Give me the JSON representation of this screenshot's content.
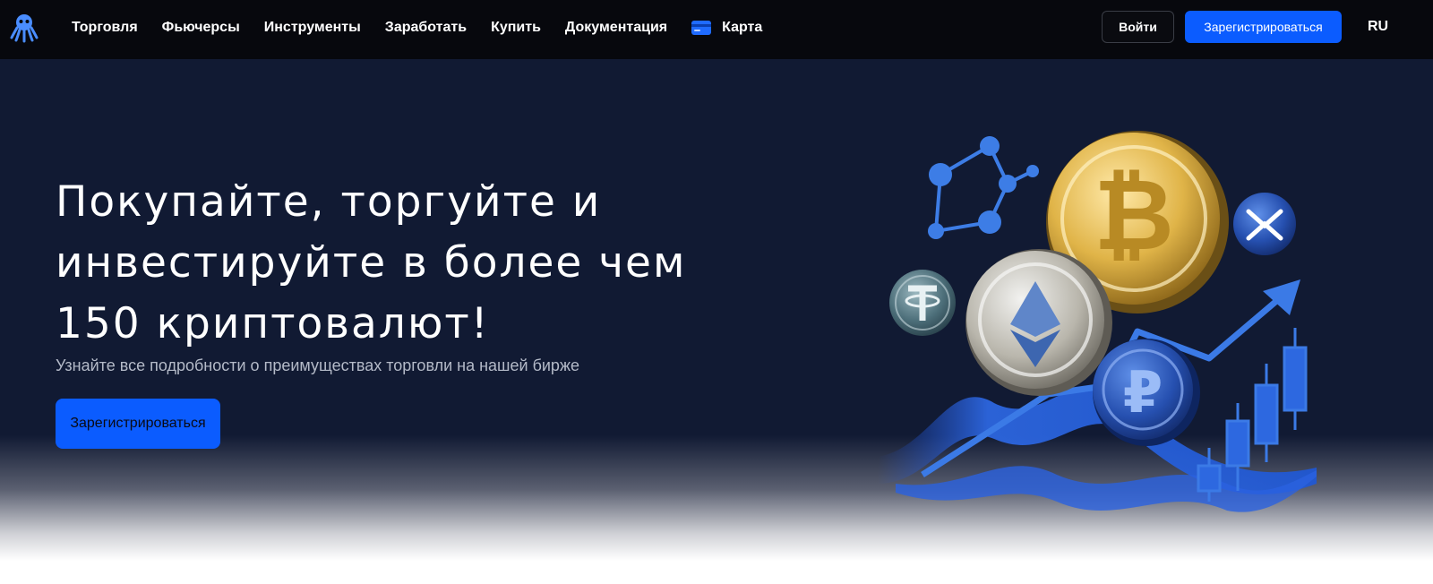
{
  "header": {
    "logo_icon": "octopus-logo-icon",
    "nav": [
      {
        "label": "Торговля"
      },
      {
        "label": "Фьючерсы"
      },
      {
        "label": "Инструменты"
      },
      {
        "label": "Заработать"
      },
      {
        "label": "Купить"
      },
      {
        "label": "Документация"
      },
      {
        "label": "Карта",
        "icon": "card-icon"
      }
    ],
    "login_label": "Войти",
    "signup_label": "Зарегистрироваться",
    "language": "RU"
  },
  "hero": {
    "title": "Покупайте, торгуйте и инвестируйте в более чем 150 криптовалют!",
    "subtitle": "Узнайте все подробности о преимуществах торговли на нашей бирже",
    "cta_label": "Зарегистрироваться",
    "illustration_icons": [
      "bitcoin-coin-icon",
      "ethereum-coin-icon",
      "tether-coin-icon",
      "xrp-coin-icon",
      "ruble-coin-icon",
      "network-nodes-icon",
      "growth-arrow-icon",
      "candlestick-icon"
    ]
  },
  "colors": {
    "accent": "#0b5cff",
    "nav_bg": "#07080d",
    "hero_bg": "#111a33"
  }
}
